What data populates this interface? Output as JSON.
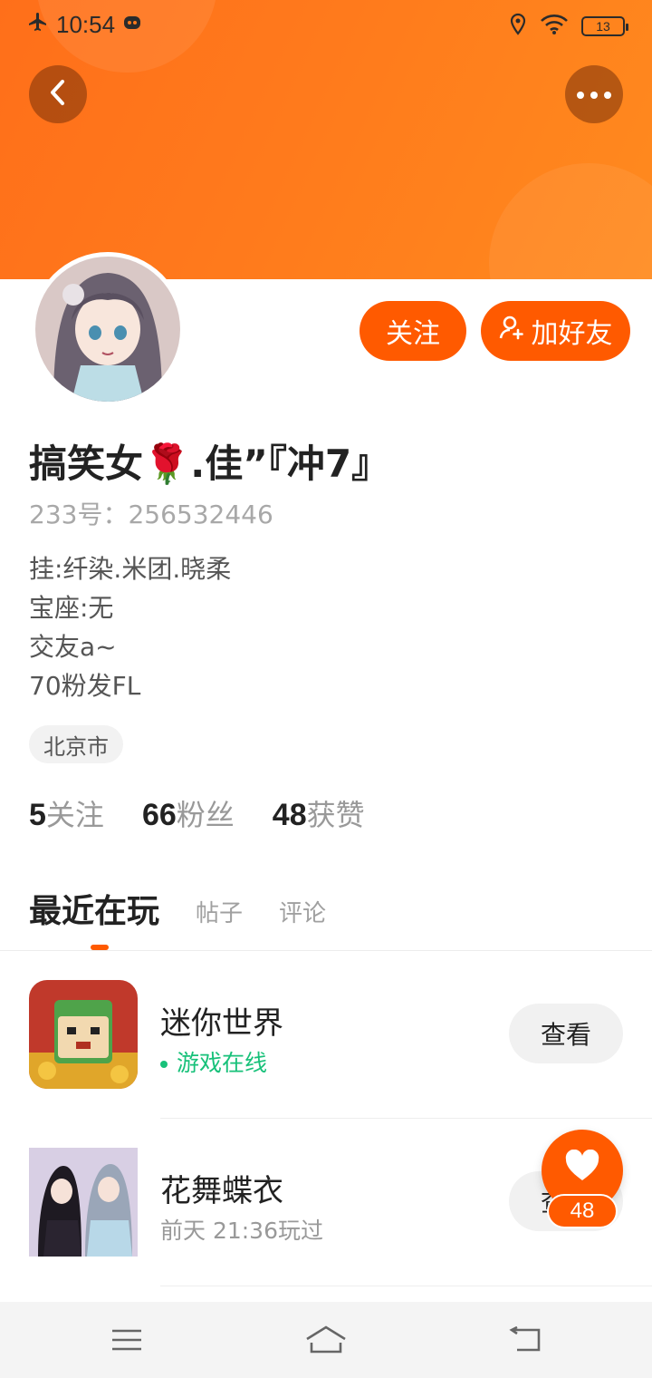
{
  "status_bar": {
    "time": "10:54",
    "battery": "13",
    "icons": [
      "airplane-icon",
      "app-notification-icon",
      "location-icon",
      "wifi-icon",
      "battery-icon"
    ]
  },
  "header": {
    "back_icon": "chevron-left-icon",
    "more_icon": "more-dots-icon"
  },
  "actions": {
    "follow_label": "关注",
    "add_friend_label": "加好友",
    "add_friend_icon": "add-user-icon"
  },
  "profile": {
    "name": "搞笑女🌹.佳”『冲7』",
    "id_text": "233号：256532446",
    "bio": [
      "挂:纤染.米团.晓柔",
      "宝座:无",
      "交友a~",
      "70粉发FL"
    ],
    "location": "北京市"
  },
  "stats": [
    {
      "num": "5",
      "label": "关注"
    },
    {
      "num": "66",
      "label": "粉丝"
    },
    {
      "num": "48",
      "label": "获赞"
    }
  ],
  "tabs": [
    {
      "label": "最近在玩",
      "active": true
    },
    {
      "label": "帖子",
      "active": false
    },
    {
      "label": "评论",
      "active": false
    }
  ],
  "games": [
    {
      "title": "迷你世界",
      "status": "游戏在线",
      "online": true,
      "button": "查看"
    },
    {
      "title": "花舞蝶衣",
      "status": "前天 21:36玩过",
      "online": false,
      "button": "查看"
    }
  ],
  "like": {
    "count": "48",
    "icon": "heart-icon"
  },
  "nav": {
    "icons": [
      "menu-icon",
      "home-icon",
      "back-icon"
    ]
  },
  "colors": {
    "accent": "#ff5a00",
    "header": "#ff7a1c",
    "online": "#18c17a"
  }
}
